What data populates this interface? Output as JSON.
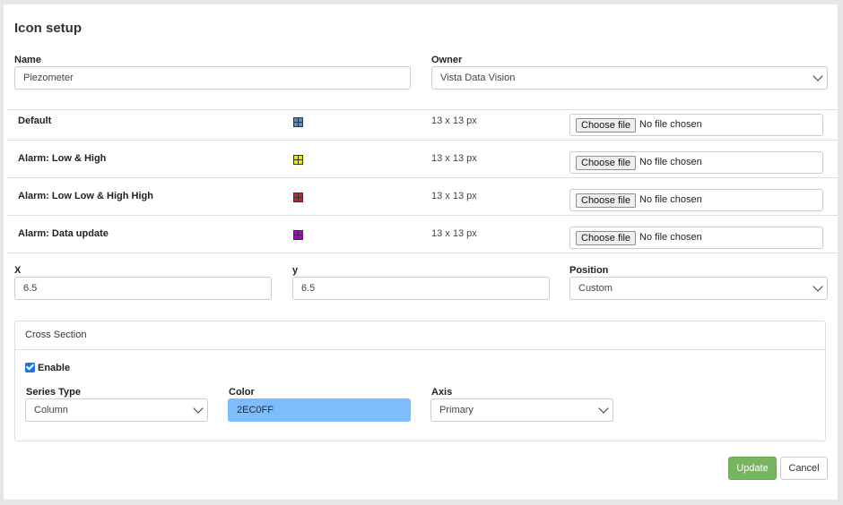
{
  "header": {
    "title": "Icon setup"
  },
  "form": {
    "name_label": "Name",
    "name_value": "Piezometer",
    "owner_label": "Owner",
    "owner_value": "Vista Data Vision",
    "x_label": "X",
    "x_value": "6.5",
    "y_label": "y",
    "y_value": "6.5",
    "position_label": "Position",
    "position_value": "Custom"
  },
  "icons": [
    {
      "label": "Default",
      "size": "13 x 13 px",
      "color": "#4a90d9",
      "icon": "grid-square-icon",
      "button": "Choose file",
      "status": "No file chosen"
    },
    {
      "label": "Alarm: Low & High",
      "size": "13 x 13 px",
      "color": "#f5e400",
      "icon": "grid-square-icon",
      "button": "Choose file",
      "status": "No file chosen"
    },
    {
      "label": "Alarm: Low Low & High High",
      "size": "13 x 13 px",
      "color": "#c62828",
      "icon": "grid-square-icon",
      "button": "Choose file",
      "status": "No file chosen"
    },
    {
      "label": "Alarm: Data update",
      "size": "13 x 13 px",
      "color": "#b100d6",
      "icon": "grid-square-icon",
      "button": "Choose file",
      "status": "No file chosen"
    }
  ],
  "cross_section": {
    "header": "Cross Section",
    "enable_label": "Enable",
    "enabled": true,
    "series_type_label": "Series Type",
    "series_type_value": "Column",
    "color_label": "Color",
    "color_value": "2EC0FF",
    "color_swatch": "#7dbdfc",
    "axis_label": "Axis",
    "axis_value": "Primary"
  },
  "actions": {
    "update": "Update",
    "cancel": "Cancel",
    "update_color": "#78b560"
  }
}
